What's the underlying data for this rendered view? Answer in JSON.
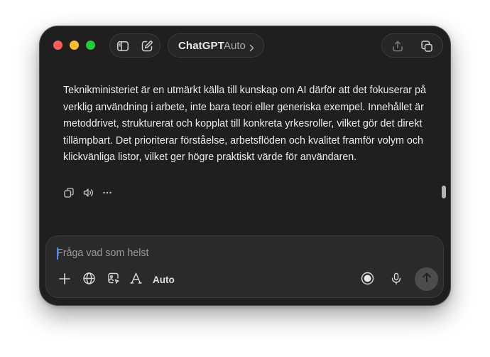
{
  "header": {
    "model_name": "ChatGPT",
    "model_mode": "Auto"
  },
  "message": {
    "text": "Teknikministeriet är en utmärkt källa till kunskap om AI därför att det fokuserar på verklig användning i arbete, inte bara teori eller generiska exempel. Innehållet är metoddrivet, strukturerat och kopplat till konkreta yrkesroller, vilket gör det direkt tillämpbart. Det prioriterar förståelse, arbetsflöden och kvalitet framför volym och klickvänliga listor, vilket ger högre praktiskt värde för användaren."
  },
  "composer": {
    "placeholder": "Fråga vad som helst",
    "value": "",
    "mode_label": "Auto"
  },
  "colors": {
    "window_bg": "#1f1f1f",
    "composer_bg": "#2a2a2a",
    "text": "#ececec",
    "traffic_red": "#ff5f57",
    "traffic_yellow": "#febc2e",
    "traffic_green": "#28c840",
    "caret": "#4a8cff"
  },
  "icons": {
    "sidebar": "sidebar-toggle-icon",
    "new_chat": "new-chat-icon",
    "model_chevron": "chevron-right-icon",
    "share": "share-icon",
    "temporary_chat": "temporary-chat-icon",
    "copy": "copy-icon",
    "read_aloud": "speaker-icon",
    "more": "more-icon",
    "add": "plus-icon",
    "search": "globe-icon",
    "image": "image-icon",
    "tools": "tools-icon",
    "voice_mode": "voice-mode-icon",
    "dictate": "microphone-icon",
    "send": "arrow-up-icon"
  }
}
